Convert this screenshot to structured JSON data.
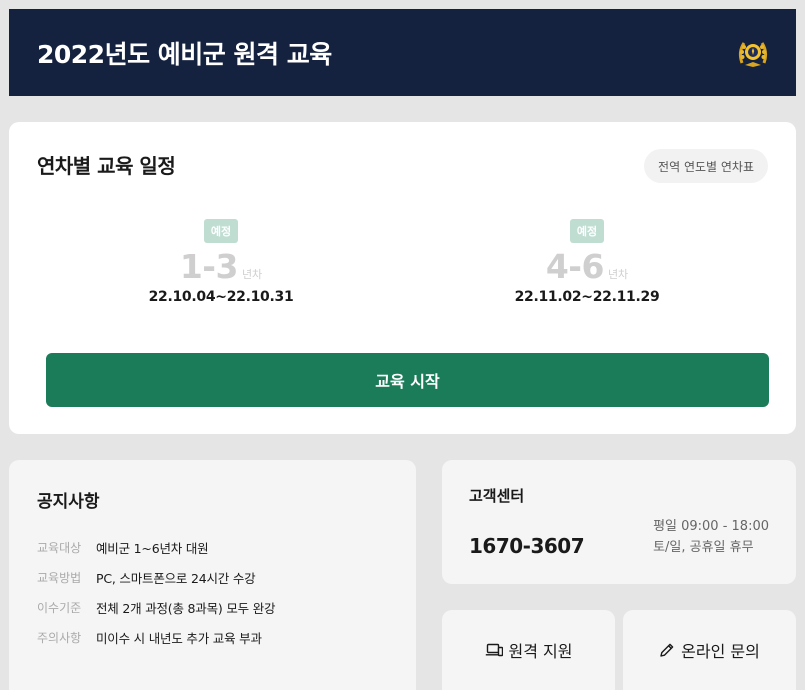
{
  "header": {
    "title": "2022년도 예비군 원격 교육",
    "emblem_icon": "army-emblem-icon"
  },
  "schedule": {
    "title": "연차별 교육 일정",
    "yearly_chip_label": "전역 연도별 연차표",
    "periods": [
      {
        "badge": "예정",
        "range": "1-3",
        "unit": "년차",
        "dates": "22.10.04~22.10.31"
      },
      {
        "badge": "예정",
        "range": "4-6",
        "unit": "년차",
        "dates": "22.11.02~22.11.29"
      }
    ],
    "start_label": "교육 시작"
  },
  "notice": {
    "title": "공지사항",
    "rows": [
      {
        "key": "교육대상",
        "value": "예비군 1~6년차 대원"
      },
      {
        "key": "교육방법",
        "value": "PC, 스마트폰으로 24시간 수강"
      },
      {
        "key": "이수기준",
        "value": "전체 2개 과정(총 8과목) 모두 완강"
      },
      {
        "key": "주의사항",
        "value": "미이수 시 내년도 추가 교육 부과"
      }
    ]
  },
  "customer_center": {
    "title": "고객센터",
    "phone": "1670-3607",
    "hours_weekday": "평일 09:00 - 18:00",
    "hours_weekend": "토/일, 공휴일 휴무"
  },
  "actions": {
    "remote_support_label": "원격 지원",
    "online_inquiry_label": "온라인 문의"
  },
  "colors": {
    "header_bg": "#14213f",
    "primary_green": "#1b7c59",
    "badge_green": "#c0ddd2"
  }
}
